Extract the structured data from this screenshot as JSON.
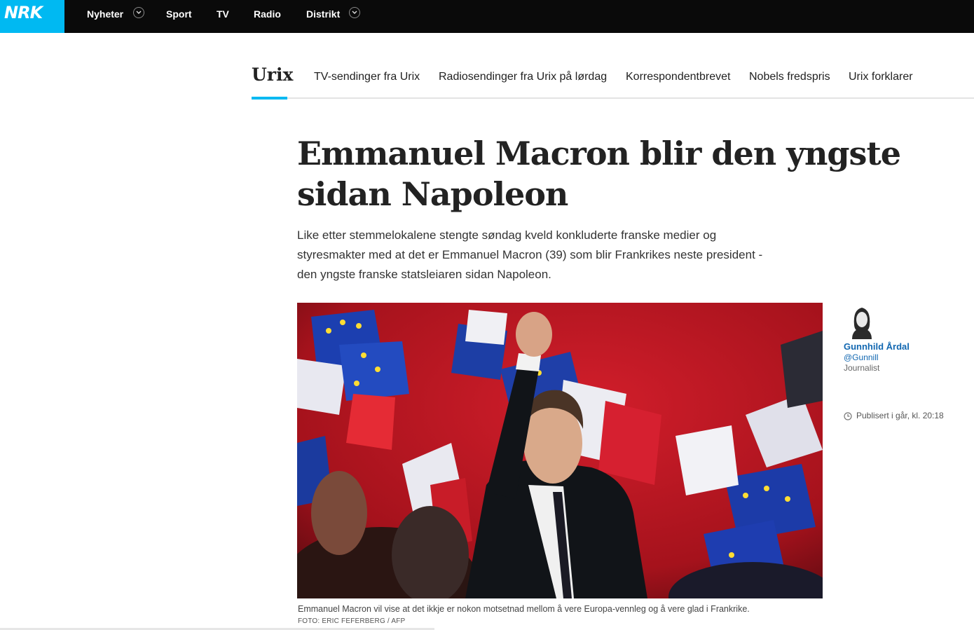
{
  "topnav": {
    "logo": "NRK",
    "items": [
      {
        "label": "Nyheter",
        "has_dropdown": true
      },
      {
        "label": "Sport",
        "has_dropdown": false
      },
      {
        "label": "TV",
        "has_dropdown": false
      },
      {
        "label": "Radio",
        "has_dropdown": false
      },
      {
        "label": "Distrikt",
        "has_dropdown": true
      }
    ]
  },
  "section": {
    "title": "Urix",
    "links": [
      "TV-sendinger fra Urix",
      "Radiosendinger fra Urix på lørdag",
      "Korrespondentbrevet",
      "Nobels fredspris",
      "Urix forklarer"
    ]
  },
  "article": {
    "headline": "Emmanuel Macron blir den yngste sidan Napoleon",
    "lead": "Like etter stemmelokalene stengte søndag kveld konkluderte franske medier og styresmakter med at det er Emmanuel Macron (39) som blir Frankrikes neste president - den yngste franske statsleiaren sidan Napoleon.",
    "image_caption": "Emmanuel Macron vil vise at det ikkje er nokon motsetnad mellom å vere Europa-vennleg og å vere glad i Frankrike.",
    "image_credit": "FOTO: ERIC FEFERBERG / AFP"
  },
  "byline": {
    "name": "Gunnhild Årdal",
    "handle": "@Gunnill",
    "role": "Journalist",
    "published": "Publisert i går, kl. 20:18"
  },
  "colors": {
    "topbar": "#0a0a0a",
    "brand": "#00b9f2",
    "link": "#1167b1"
  }
}
